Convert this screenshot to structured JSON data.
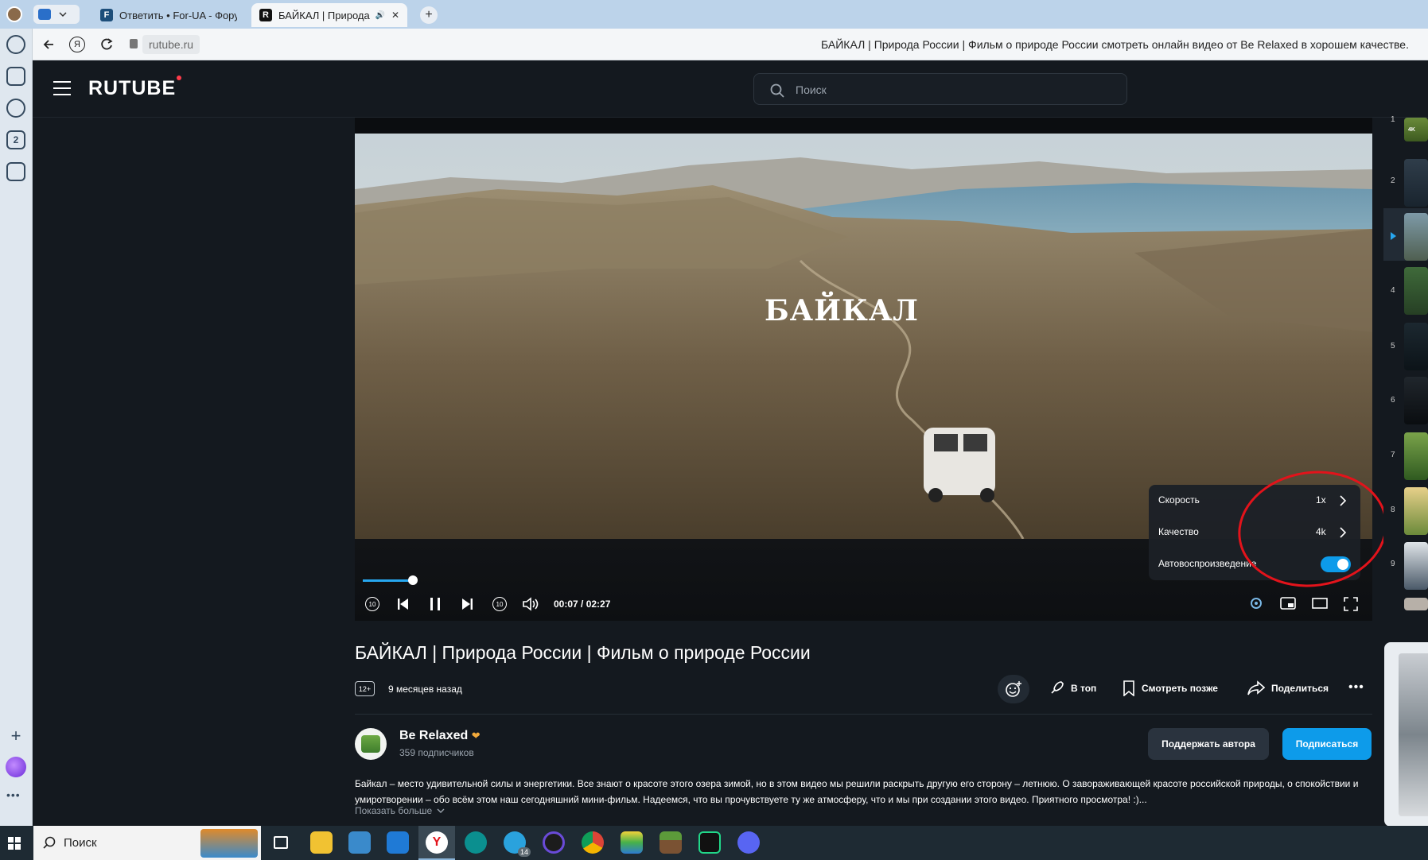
{
  "browser": {
    "tabs": [
      {
        "title": "Ответить • For-UA - Форум",
        "favicon": "F",
        "color": "#1d4e7a"
      },
      {
        "title": "БАЙКАЛ | Природа Росси",
        "favicon": "R",
        "color": "#111"
      }
    ],
    "address": "rutube.ru",
    "page_title": "БАЙКАЛ | Природа России | Фильм о природе России смотреть онлайн видео от Be Relaxed в хорошем качестве.",
    "left_badge": "2"
  },
  "site": {
    "logo": "RUTUBE",
    "search_placeholder": "Поиск"
  },
  "player": {
    "overlay_title": "БАЙКАЛ",
    "time": "00:07 / 02:27",
    "progress": 0.05,
    "settings": {
      "speed_label": "Скорость",
      "speed_value": "1x",
      "quality_label": "Качество",
      "quality_value": "4k",
      "autoplay_label": "Автовоспроизведение",
      "autoplay_on": true
    }
  },
  "rail": {
    "numbers": [
      "1",
      "2",
      "4",
      "5",
      "6",
      "7",
      "8",
      "9"
    ],
    "badge": "4K"
  },
  "video": {
    "title": "БАЙКАЛ | Природа России | Фильм о природе России",
    "age": "12+",
    "posted": "9 месяцев назад",
    "actions": {
      "top": "В топ",
      "later": "Смотреть позже",
      "share": "Поделиться"
    },
    "channel": {
      "name": "Be Relaxed",
      "subs": "359 подписчиков",
      "support": "Поддержать автора",
      "subscribe": "Подписаться"
    },
    "description_1": "Байкал – место удивительной силы и энергетики. Все знают о красоте этого озера зимой, но в этом видео мы решили раскрыть другую его сторону – летнюю. О завораживающей красоте российской природы, о спокойствии и",
    "description_2": "умиротворении – обо всём этом наш сегодняшний мини-фильм. Надеемся, что вы прочувствуете ту же атмосферу, что и мы при создании этого видео. Приятного просмотра! :)...",
    "show_more": "Показать больше"
  },
  "taskbar": {
    "search": "Поиск",
    "telegram_badge": "14"
  }
}
